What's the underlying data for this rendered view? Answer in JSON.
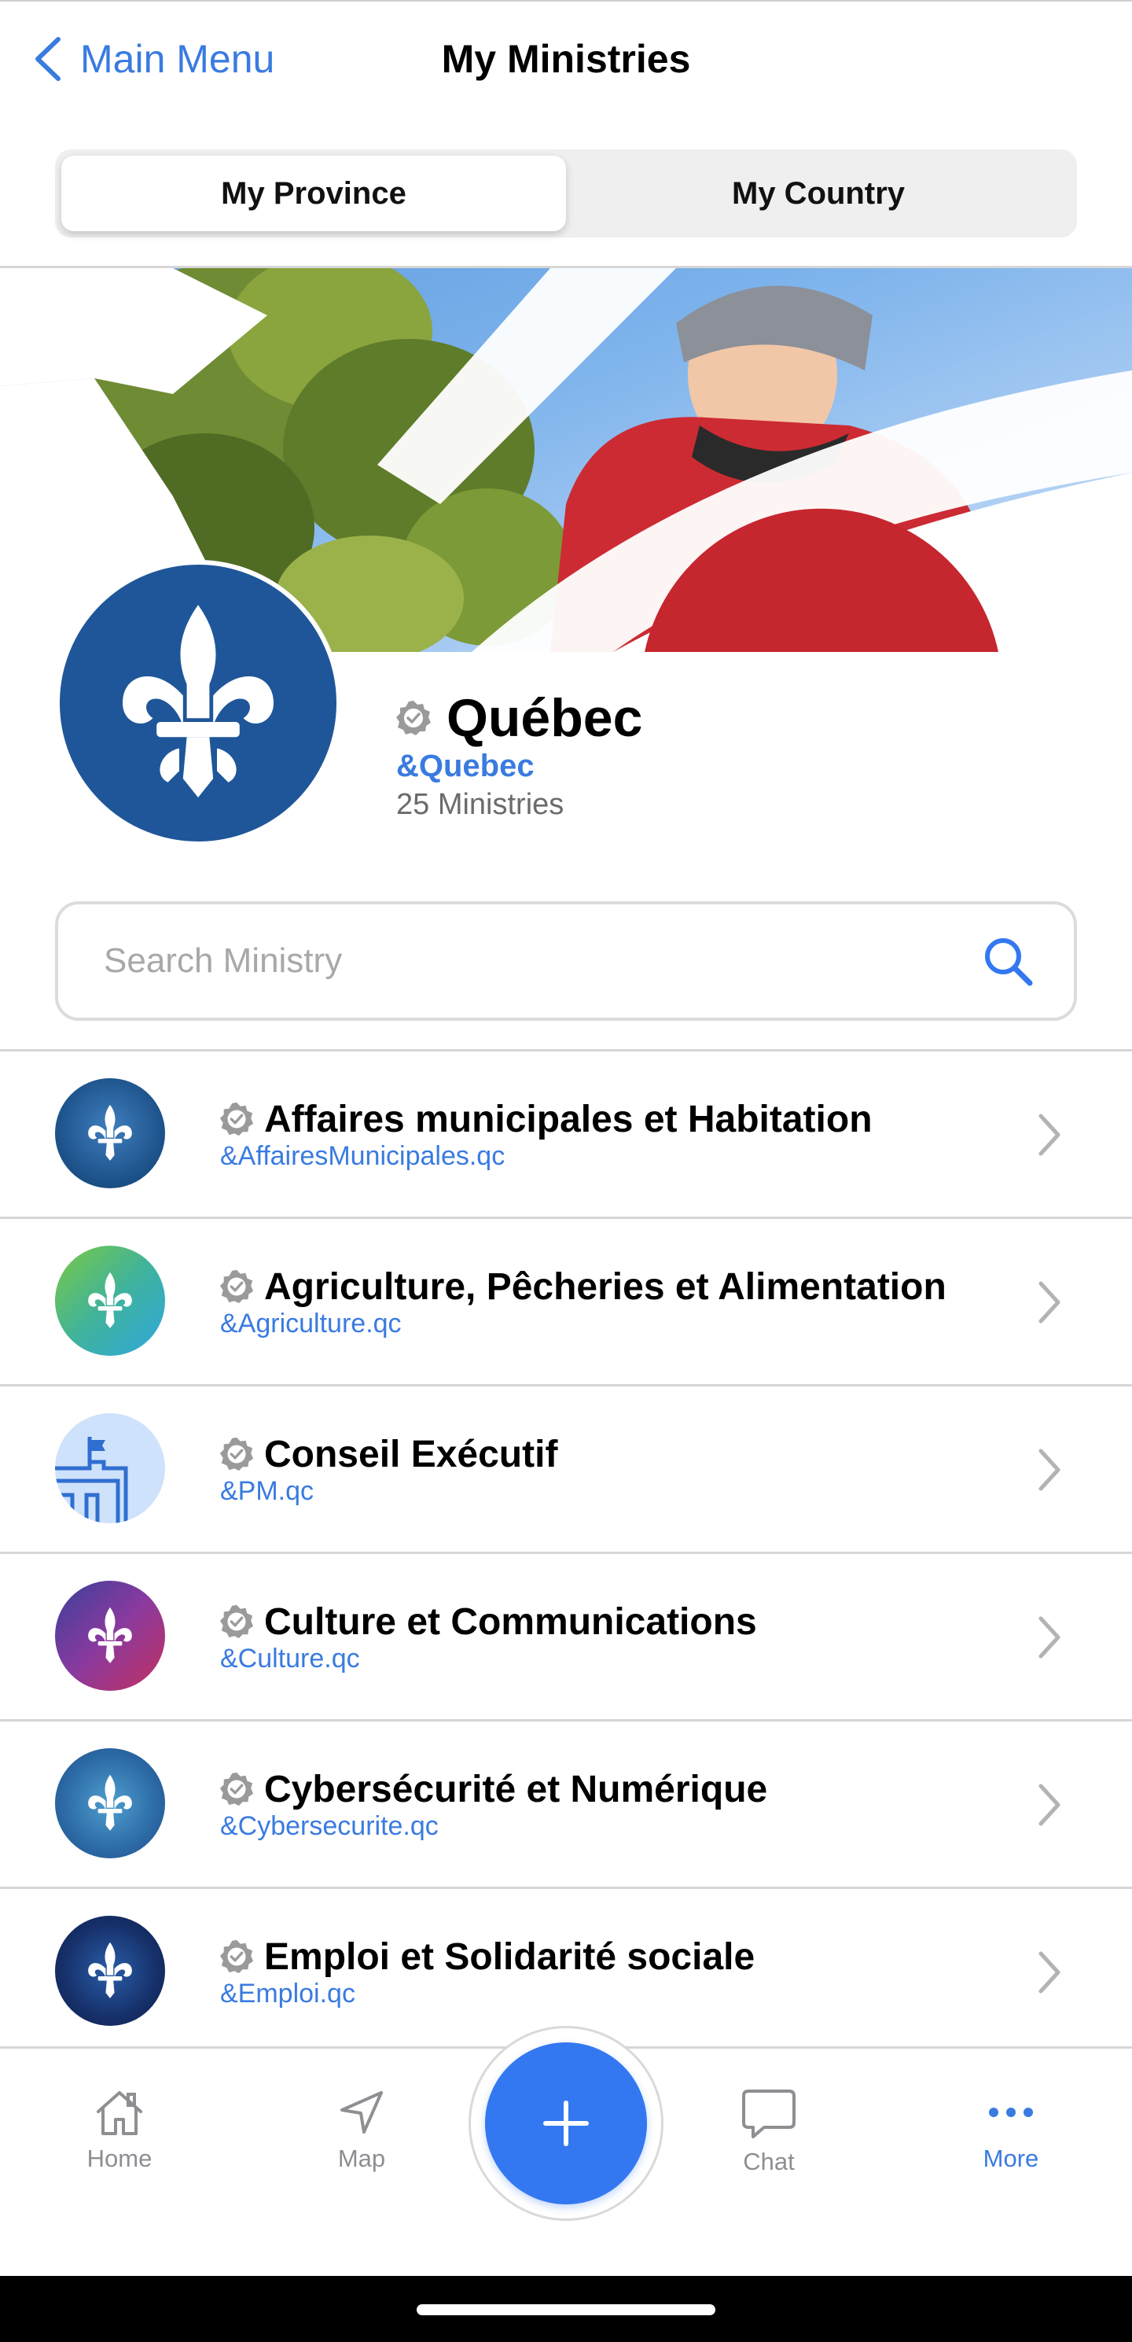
{
  "header": {
    "back_label": "Main Menu",
    "title": "My Ministries"
  },
  "segment": {
    "tabs": [
      {
        "label": "My Province",
        "active": true
      },
      {
        "label": "My Country",
        "active": false
      }
    ]
  },
  "profile": {
    "name": "Québec",
    "handle": "&Quebec",
    "count": "25 Ministries",
    "avatar_color": "#1f5699"
  },
  "search": {
    "placeholder": "Search Ministry",
    "value": ""
  },
  "ministries": [
    {
      "name": "Affaires municipales et Habitation",
      "handle": "&AffairesMunicipales.qc",
      "avatar": "fleur-navy"
    },
    {
      "name": "Agriculture, Pêcheries et Alimentation",
      "handle": "&Agriculture.qc",
      "avatar": "fleur-green"
    },
    {
      "name": "Conseil Exécutif",
      "handle": "&PM.qc",
      "avatar": "parliament-light-blue"
    },
    {
      "name": "Culture et Communications",
      "handle": "&Culture.qc",
      "avatar": "fleur-purple"
    },
    {
      "name": "Cybersécurité et Numérique",
      "handle": "&Cybersecurite.qc",
      "avatar": "fleur-teal"
    },
    {
      "name": "Emploi et Solidarité sociale",
      "handle": "&Emploi.qc",
      "avatar": "fleur-dark-navy"
    }
  ],
  "tabbar": {
    "items": [
      {
        "label": "Home",
        "icon": "home-icon",
        "active": false
      },
      {
        "label": "Map",
        "icon": "navigation-arrow-icon",
        "active": false
      },
      {
        "label": "Chat",
        "icon": "chat-bubble-icon",
        "active": false
      },
      {
        "label": "More",
        "icon": "more-dots-icon",
        "active": true
      }
    ],
    "fab_icon": "plus-icon"
  },
  "colors": {
    "accent": "#3a7be0",
    "fab": "#3478f1",
    "divider": "#d6d6d6",
    "muted_text": "#6b6b6b"
  }
}
